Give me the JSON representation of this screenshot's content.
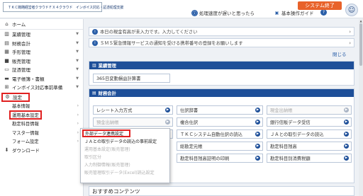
{
  "header": {
    "logo_text": "ＴＫＣ戦略経営者クラウドＦＸ４クラウド　インボイス対応・証憑処理支援",
    "link_slow": "処理速度が遅いと思ったら",
    "link_guide": "基本操作ガイド",
    "system_exit": "システム終了",
    "accent_color": "#e8622a"
  },
  "sidebar": {
    "home": "ホーム",
    "items": [
      {
        "label": "業績管理",
        "icon": "chart-icon"
      },
      {
        "label": "財務会計",
        "icon": "ledger-icon"
      },
      {
        "label": "手形管理",
        "icon": "note-icon"
      },
      {
        "label": "販売管理",
        "icon": "sales-icon"
      },
      {
        "label": "証憑管理",
        "icon": "document-icon"
      },
      {
        "label": "電子帳簿・書類",
        "icon": "folder-icon"
      },
      {
        "label": "インボイス対応事前準備",
        "icon": "invoice-icon"
      }
    ],
    "settings": "設定",
    "sub": [
      {
        "label": "基本情報"
      },
      {
        "label": "運用基本設定"
      },
      {
        "label": "勘定科目情報"
      },
      {
        "label": "マスター情報"
      },
      {
        "label": "フォーム設定"
      }
    ],
    "download": "ダウンロード"
  },
  "notices": [
    "本日の現金有高が未入力です。入力してください",
    "ＳＭＳ緊急情報サービスの通知を受ける携帯番号の登録をお願いします"
  ],
  "close_label": "閉じる",
  "panel_gyoseki": {
    "title": "業績管理",
    "buttons": [
      "365日変動損益計算書"
    ]
  },
  "panel_zaimu": {
    "title": "財務会計",
    "buttons": [
      {
        "label": "レシート入力方式",
        "disabled": false
      },
      {
        "label": "仕訳辞書",
        "disabled": false
      },
      {
        "label": "現金出納帳",
        "disabled": true
      },
      {
        "label": "預金出納帳",
        "disabled": true
      },
      {
        "label": "複合仕訳",
        "disabled": false
      },
      {
        "label": "銀行信販データ受信",
        "disabled": false
      },
      {
        "label": "ＴＫＣシステム自動仕訳の読込",
        "disabled": false
      },
      {
        "label": "ＪＡとの取引データの読込",
        "disabled": false
      },
      {
        "label": "総勘定元帳",
        "disabled": false
      },
      {
        "label": "勘定科目残高",
        "disabled": false
      },
      {
        "label": "勘定科目残高証明の印刷",
        "disabled": false
      },
      {
        "label": "勘定科目別消費税額",
        "disabled": false
      }
    ]
  },
  "flyout": {
    "items": [
      {
        "label": "外部データ連携設定",
        "disabled": false
      },
      {
        "label": "ＪＡとの取引データの読込の事前設定",
        "disabled": false
      },
      {
        "label": "運用基本設定(販売管理)",
        "disabled": true
      },
      {
        "label": "取引区分",
        "disabled": true
      },
      {
        "label": "入力制御情報(販売管理)",
        "disabled": true
      },
      {
        "label": "販売管理取引データ(Excel)読込設定",
        "disabled": true
      }
    ]
  },
  "osusume": "おすすめコンテンツ"
}
